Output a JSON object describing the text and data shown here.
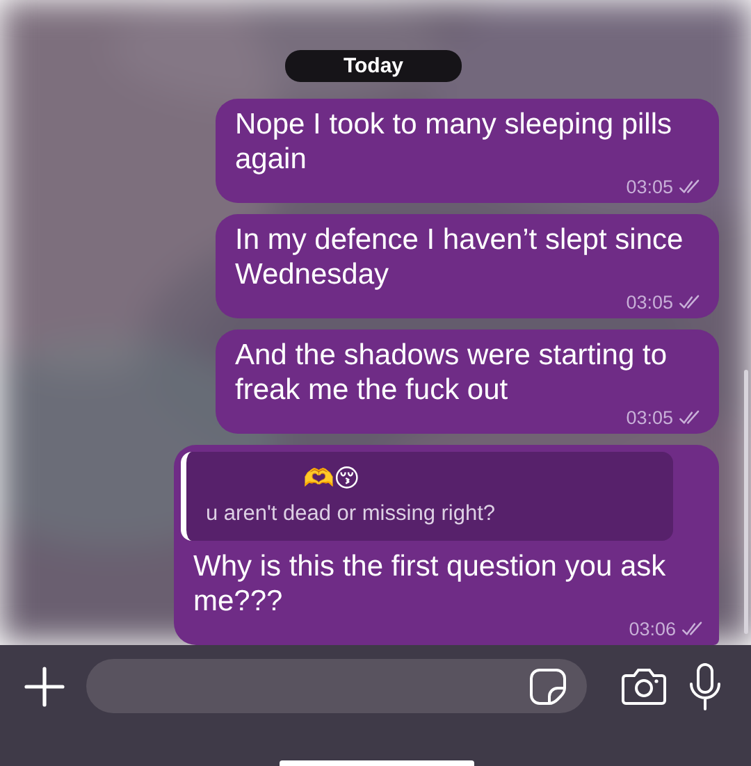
{
  "date_badge": "Today",
  "messages": [
    {
      "kind": "text",
      "text": "Nope I took to many sleeping pills again",
      "time": "03:05",
      "read": true
    },
    {
      "kind": "text",
      "text": "In my defence I haven’t slept since Wednesday",
      "time": "03:05",
      "read": true
    },
    {
      "kind": "text",
      "text": "And the shadows were starting to freak me the fuck out",
      "time": "03:05",
      "read": true
    },
    {
      "kind": "reply",
      "quote_author": "🫶😚",
      "quote_text": "u aren't dead or missing right?",
      "text": "Why is this the first question you ask me???",
      "time": "03:06",
      "read": true
    }
  ]
}
